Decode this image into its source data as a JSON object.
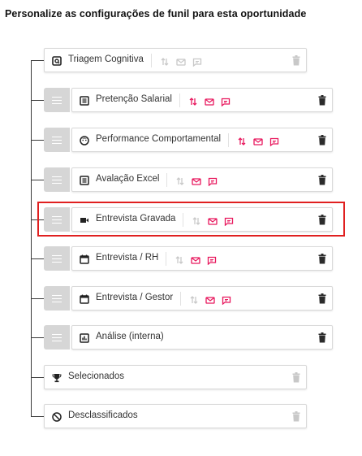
{
  "page": {
    "title": "Personalize as configurações de funil para esta oportunidade"
  },
  "colors": {
    "accent": "#e8175d",
    "muted": "#c8c8c8",
    "dark": "#2b2b2b",
    "highlight": "#e02020"
  },
  "steps": [
    {
      "label": "Triagem Cognitiva",
      "icon": "cognitive-test-icon",
      "movable": false,
      "active": false
    },
    {
      "label": "Pretenção Salarial",
      "icon": "list-icon",
      "movable": true,
      "active": true
    },
    {
      "label": "Performance Comportamental",
      "icon": "face-icon",
      "movable": true,
      "active": true
    },
    {
      "label": "Avalação Excel",
      "icon": "list-icon",
      "movable": true,
      "active": true
    },
    {
      "label": "Entrevista Gravada",
      "icon": "video-camera-icon",
      "movable": true,
      "active": true
    },
    {
      "label": "Entrevista / RH",
      "icon": "calendar-icon",
      "movable": true,
      "active": true
    },
    {
      "label": "Entrevista / Gestor",
      "icon": "calendar-icon",
      "movable": true,
      "active": true
    },
    {
      "label": "Análise (interna)",
      "icon": "chart-icon",
      "movable": true,
      "active": true
    },
    {
      "label": "Selecionados",
      "icon": "trophy-icon",
      "movable": false,
      "active": false
    },
    {
      "label": "Desclassificados",
      "icon": "blocked-icon",
      "movable": false,
      "active": false
    }
  ]
}
